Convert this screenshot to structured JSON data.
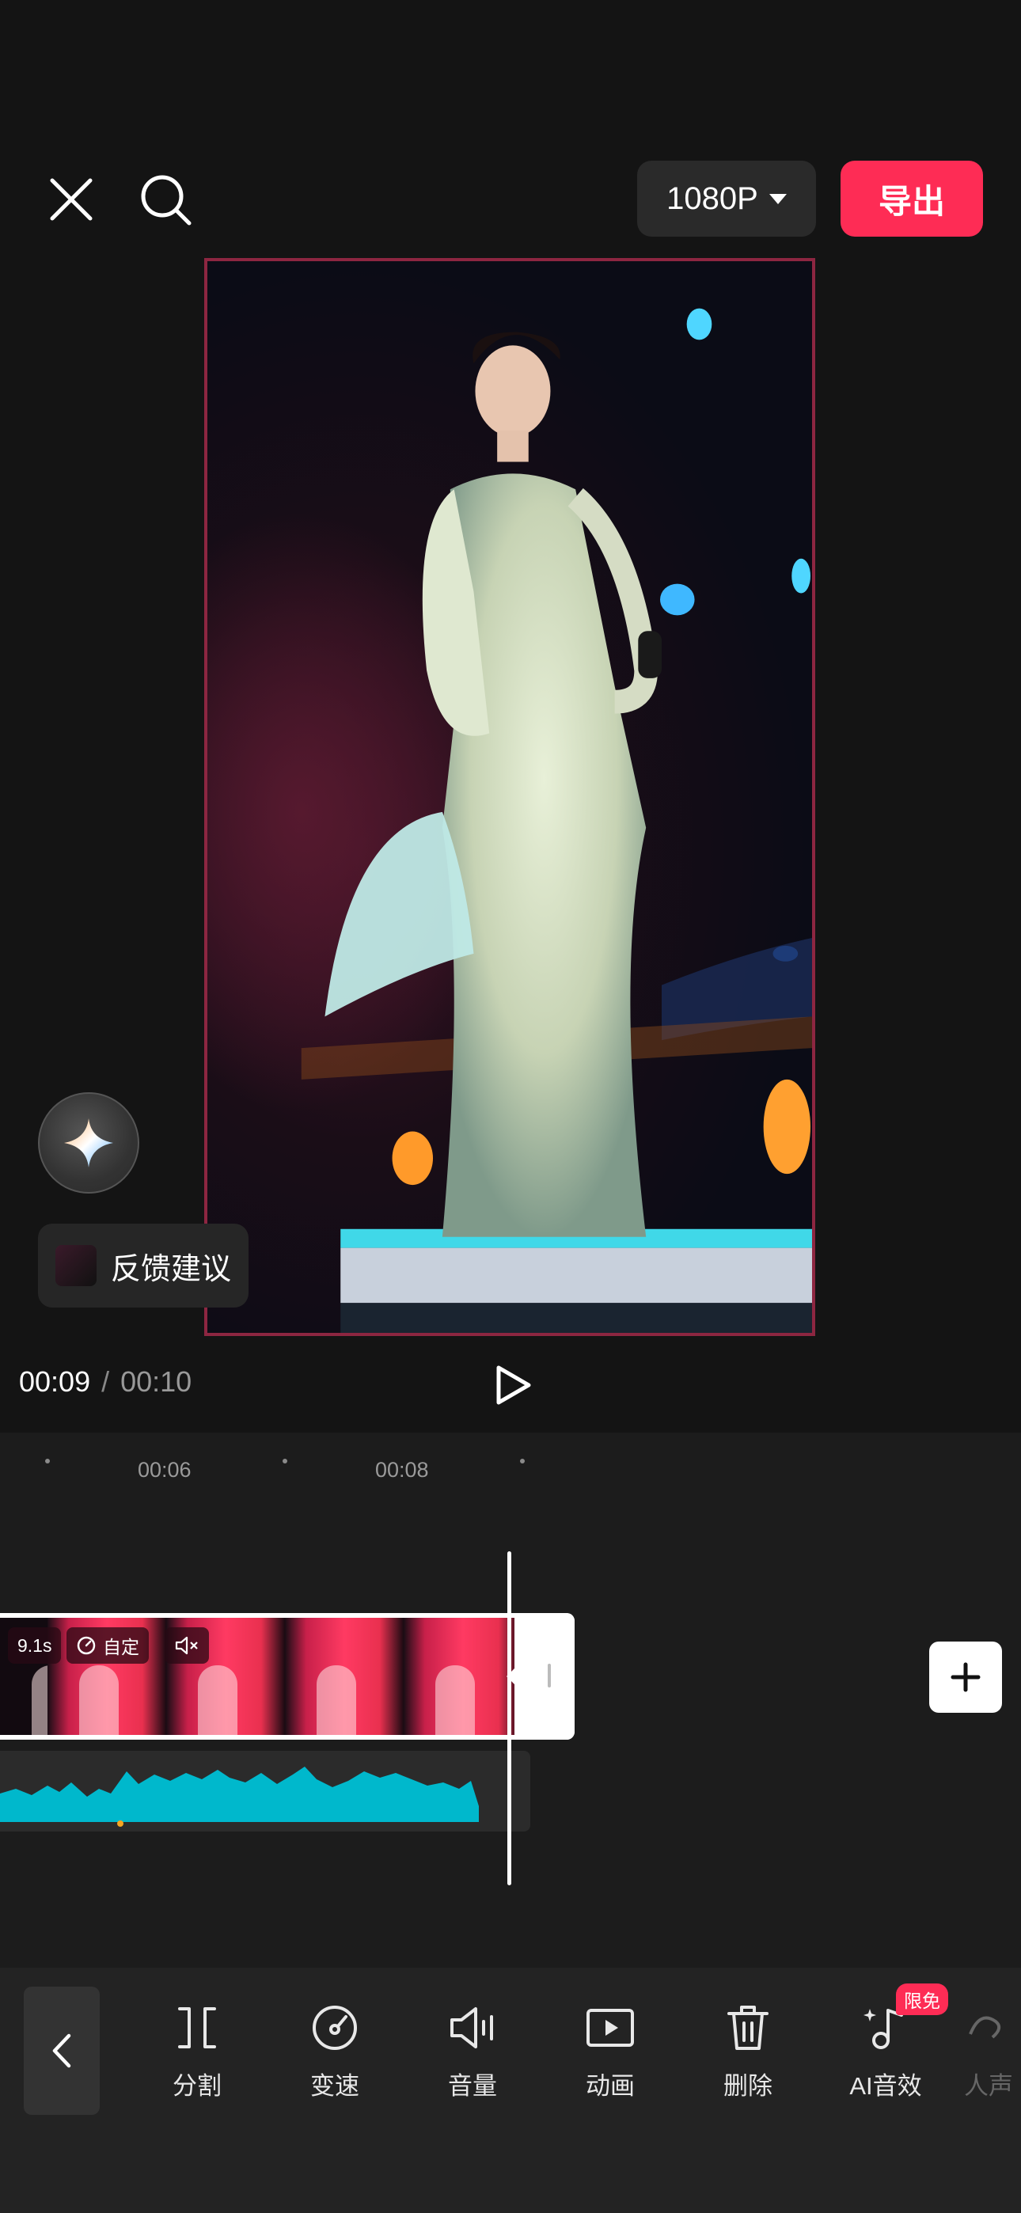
{
  "header": {
    "resolution_label": "1080P",
    "export_label": "导出"
  },
  "feedback": {
    "label": "反馈建议"
  },
  "player": {
    "current_time": "00:09",
    "separator": "/",
    "total_time": "00:10"
  },
  "timeline": {
    "ticks": [
      "00:06",
      "00:08"
    ],
    "clip": {
      "duration_label": "9.1s",
      "speed_label": "自定"
    }
  },
  "toolbar": {
    "items": [
      {
        "label": "分割",
        "icon": "split-icon"
      },
      {
        "label": "变速",
        "icon": "speed-icon"
      },
      {
        "label": "音量",
        "icon": "volume-icon"
      },
      {
        "label": "动画",
        "icon": "animation-icon"
      },
      {
        "label": "删除",
        "icon": "trash-icon"
      },
      {
        "label": "AI音效",
        "icon": "ai-sound-icon"
      },
      {
        "label": "人声",
        "icon": "voice-icon"
      }
    ],
    "limited_badge": "限免"
  },
  "colors": {
    "accent": "#fe2c55",
    "audio_wave": "#00b8cc",
    "preview_border": "#8d2641"
  }
}
